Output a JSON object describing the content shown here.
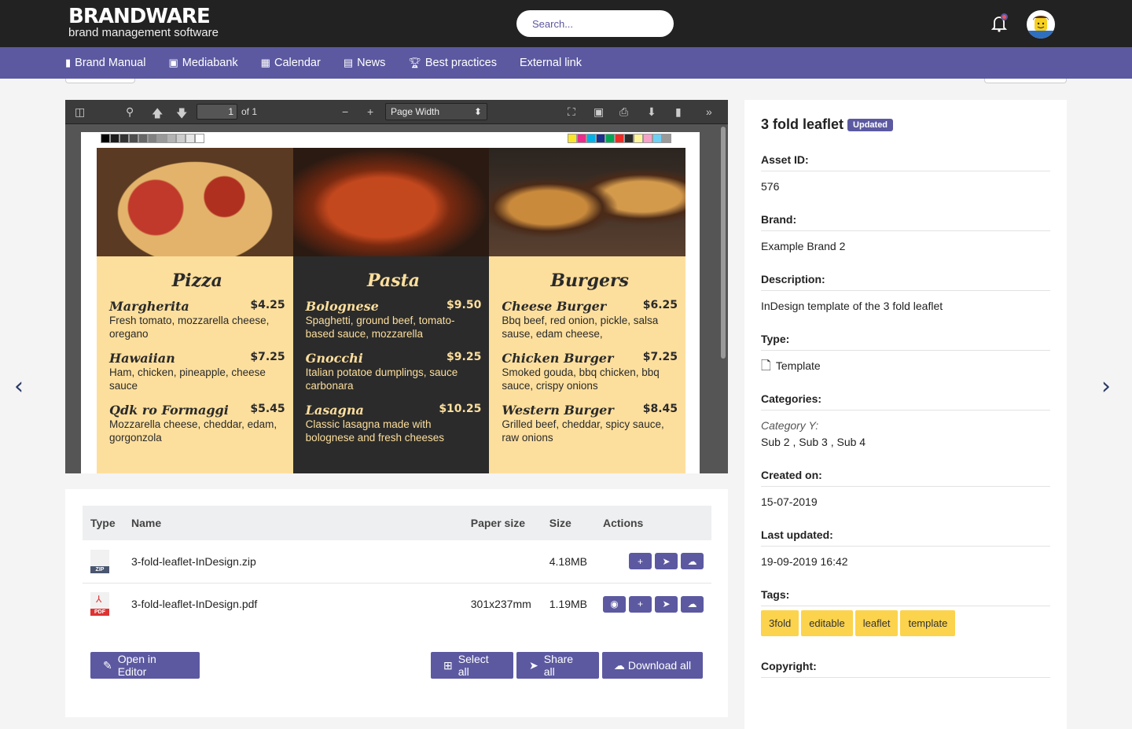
{
  "brand": {
    "name": "BRANDWARE",
    "tagline": "brand management software"
  },
  "search": {
    "placeholder": "Search..."
  },
  "nav": [
    {
      "label": "Brand Manual",
      "icon": "book-icon"
    },
    {
      "label": "Mediabank",
      "icon": "image-icon"
    },
    {
      "label": "Calendar",
      "icon": "calendar-icon"
    },
    {
      "label": "News",
      "icon": "newspaper-icon"
    },
    {
      "label": "Best practices",
      "icon": "trophy-icon"
    },
    {
      "label": "External link"
    }
  ],
  "viewer": {
    "page": "1",
    "page_of": "of 1",
    "zoom": "Page Width"
  },
  "leaflet": {
    "columns": [
      {
        "title": "Pizza",
        "items": [
          {
            "name": "Margherita",
            "price": "$4.25",
            "desc": "Fresh tomato, mozzarella cheese, oregano"
          },
          {
            "name": "Hawaiian",
            "price": "$7.25",
            "desc": "Ham, chicken, pineapple, cheese sauce"
          },
          {
            "name": "Qdk  ro Formaggi",
            "price": "$5.45",
            "desc": "Mozzarella cheese, cheddar, edam, gorgonzola"
          }
        ]
      },
      {
        "title": "Pasta",
        "items": [
          {
            "name": "Bolognese",
            "price": "$9.50",
            "desc": "Spaghetti, ground beef, tomato-based sauce, mozzarella"
          },
          {
            "name": "Gnocchi",
            "price": "$9.25",
            "desc": "Italian potatoe dumplings, sauce carbonara"
          },
          {
            "name": "Lasagna",
            "price": "$10.25",
            "desc": "Classic lasagna made with bolognese and fresh cheeses"
          }
        ]
      },
      {
        "title": "Burgers",
        "items": [
          {
            "name": "Cheese Burger",
            "price": "$6.25",
            "desc": "Bbq beef, red onion, pickle, salsa sause, edam cheese,"
          },
          {
            "name": "Chicken Burger",
            "price": "$7.25",
            "desc": "Smoked gouda, bbq chicken, bbq sauce, crispy onions"
          },
          {
            "name": "Western Burger",
            "price": "$8.45",
            "desc": "Grilled beef, cheddar, spicy sauce, raw onions"
          }
        ]
      }
    ]
  },
  "files": {
    "headers": [
      "Type",
      "Name",
      "Paper size",
      "Size",
      "Actions"
    ],
    "rows": [
      {
        "type": "ZIP",
        "name": "3-fold-leaflet-InDesign.zip",
        "paper": "",
        "size": "4.18MB"
      },
      {
        "type": "PDF",
        "name": "3-fold-leaflet-InDesign.pdf",
        "paper": "301x237mm",
        "size": "1.19MB"
      }
    ],
    "open_editor": "Open in Editor",
    "select_all": "Select all",
    "share_all": "Share all",
    "download_all": "Download all"
  },
  "details": {
    "title": "3 fold leaflet",
    "badge": "Updated",
    "asset_id_label": "Asset ID:",
    "asset_id": "576",
    "brand_label": "Brand:",
    "brand": "Example Brand 2",
    "description_label": "Description:",
    "description": "InDesign template of the 3 fold leaflet",
    "type_label": "Type:",
    "type": "Template",
    "categories_label": "Categories:",
    "category": "Category Y:",
    "subs": "Sub 2 , Sub 3 , Sub 4",
    "created_label": "Created on:",
    "created": "15-07-2019",
    "updated_label": "Last updated:",
    "updated": "19-09-2019 16:42",
    "tags_label": "Tags:",
    "tags": [
      "3fold",
      "editable",
      "leaflet",
      "template"
    ],
    "copyright_label": "Copyright:"
  },
  "colors": {
    "header": "#222222",
    "nav": "#5c59a1",
    "tag": "#fcd34d",
    "menu_light": "#fddf9d",
    "menu_dark": "#2b2b2b"
  }
}
